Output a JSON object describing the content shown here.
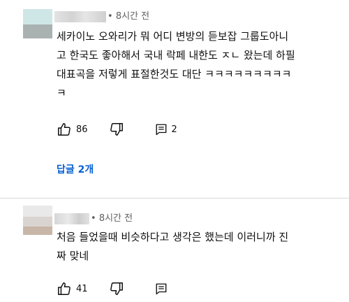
{
  "comments": [
    {
      "time": "8시간 전",
      "lines": [
        "세카이노 오와리가 뭐 어디 변방의 듣보잡 그룹도아니",
        "고 한국도 좋아해서 국내 락페 내한도 ㅈㄴ 왔는데 하필",
        "대표곡을 저렇게  표절한것도 대단 ㅋㅋㅋㅋㅋㅋㅋㅋㅋ",
        "ㅋ"
      ],
      "likes": "86",
      "reply_count": "2",
      "view_replies_label": "답글 2개"
    },
    {
      "time": "8시간 전",
      "lines": [
        "처음 들었을때 비슷하다고 생각은 했는데 이러니까 진",
        "짜 맞네"
      ],
      "likes": "41",
      "reply_count": ""
    }
  ],
  "icons": {
    "like": "thumbs-up-icon",
    "dislike": "thumbs-down-icon",
    "reply": "reply-comment-icon"
  },
  "colors": {
    "link": "#065fd4",
    "meta": "#606060",
    "text": "#0f0f0f"
  }
}
